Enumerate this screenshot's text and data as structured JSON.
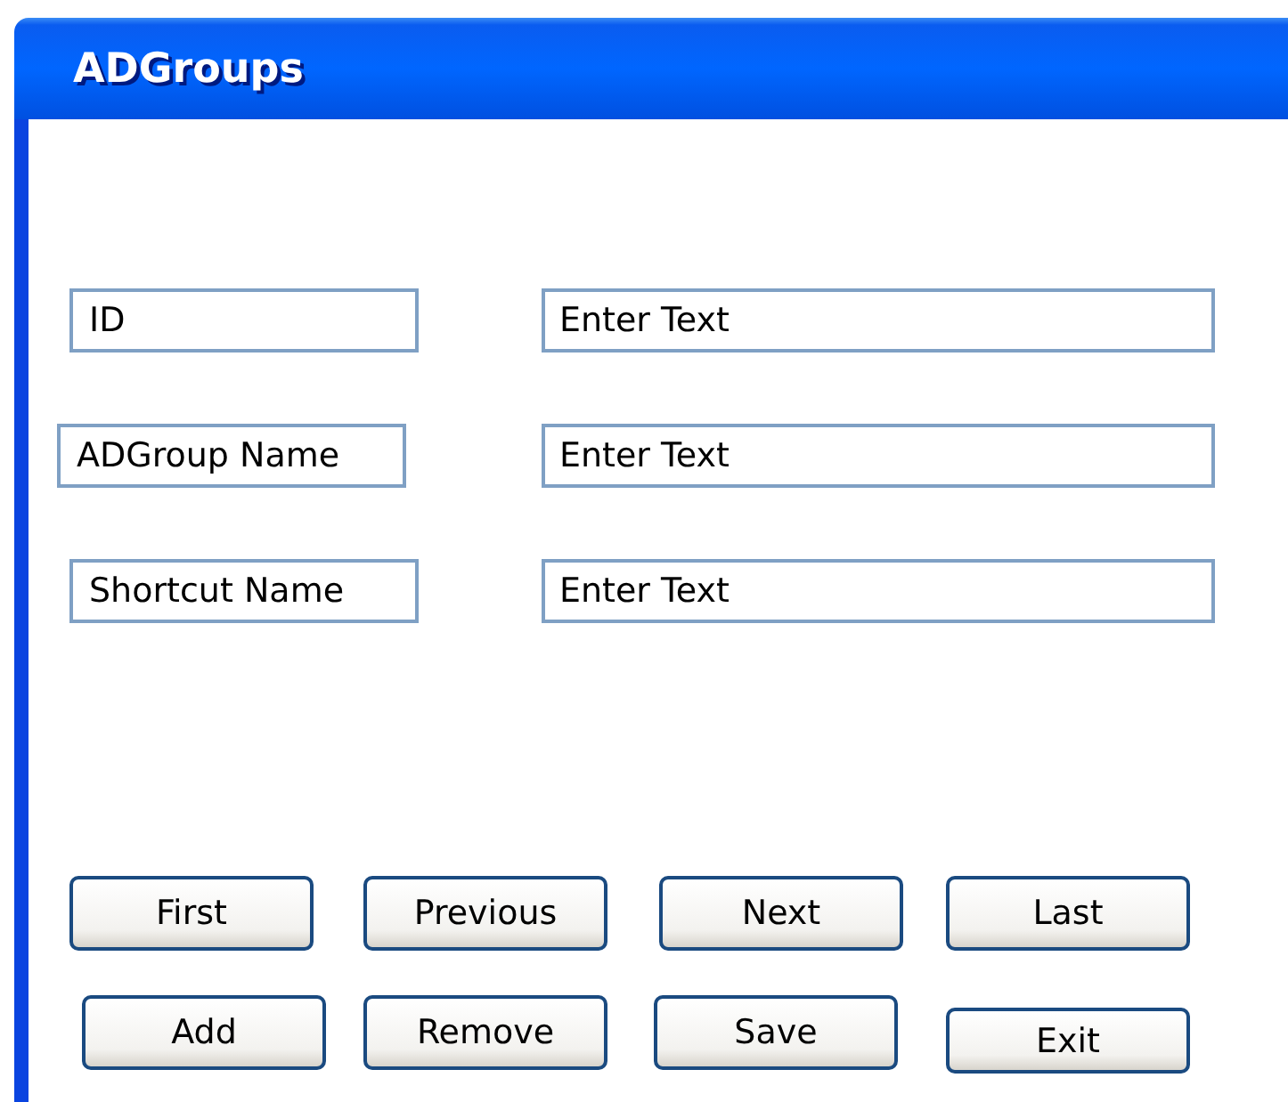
{
  "window": {
    "title": "ADGroups"
  },
  "fields": [
    {
      "label": "ID",
      "placeholder": "Enter Text"
    },
    {
      "label": "ADGroup Name",
      "placeholder": "Enter Text"
    },
    {
      "label": "Shortcut Name",
      "placeholder": "Enter Text"
    }
  ],
  "buttons": [
    [
      "First",
      "Previous",
      "Next",
      "Last"
    ],
    [
      "Add",
      "Remove",
      "Save",
      "Exit"
    ]
  ]
}
